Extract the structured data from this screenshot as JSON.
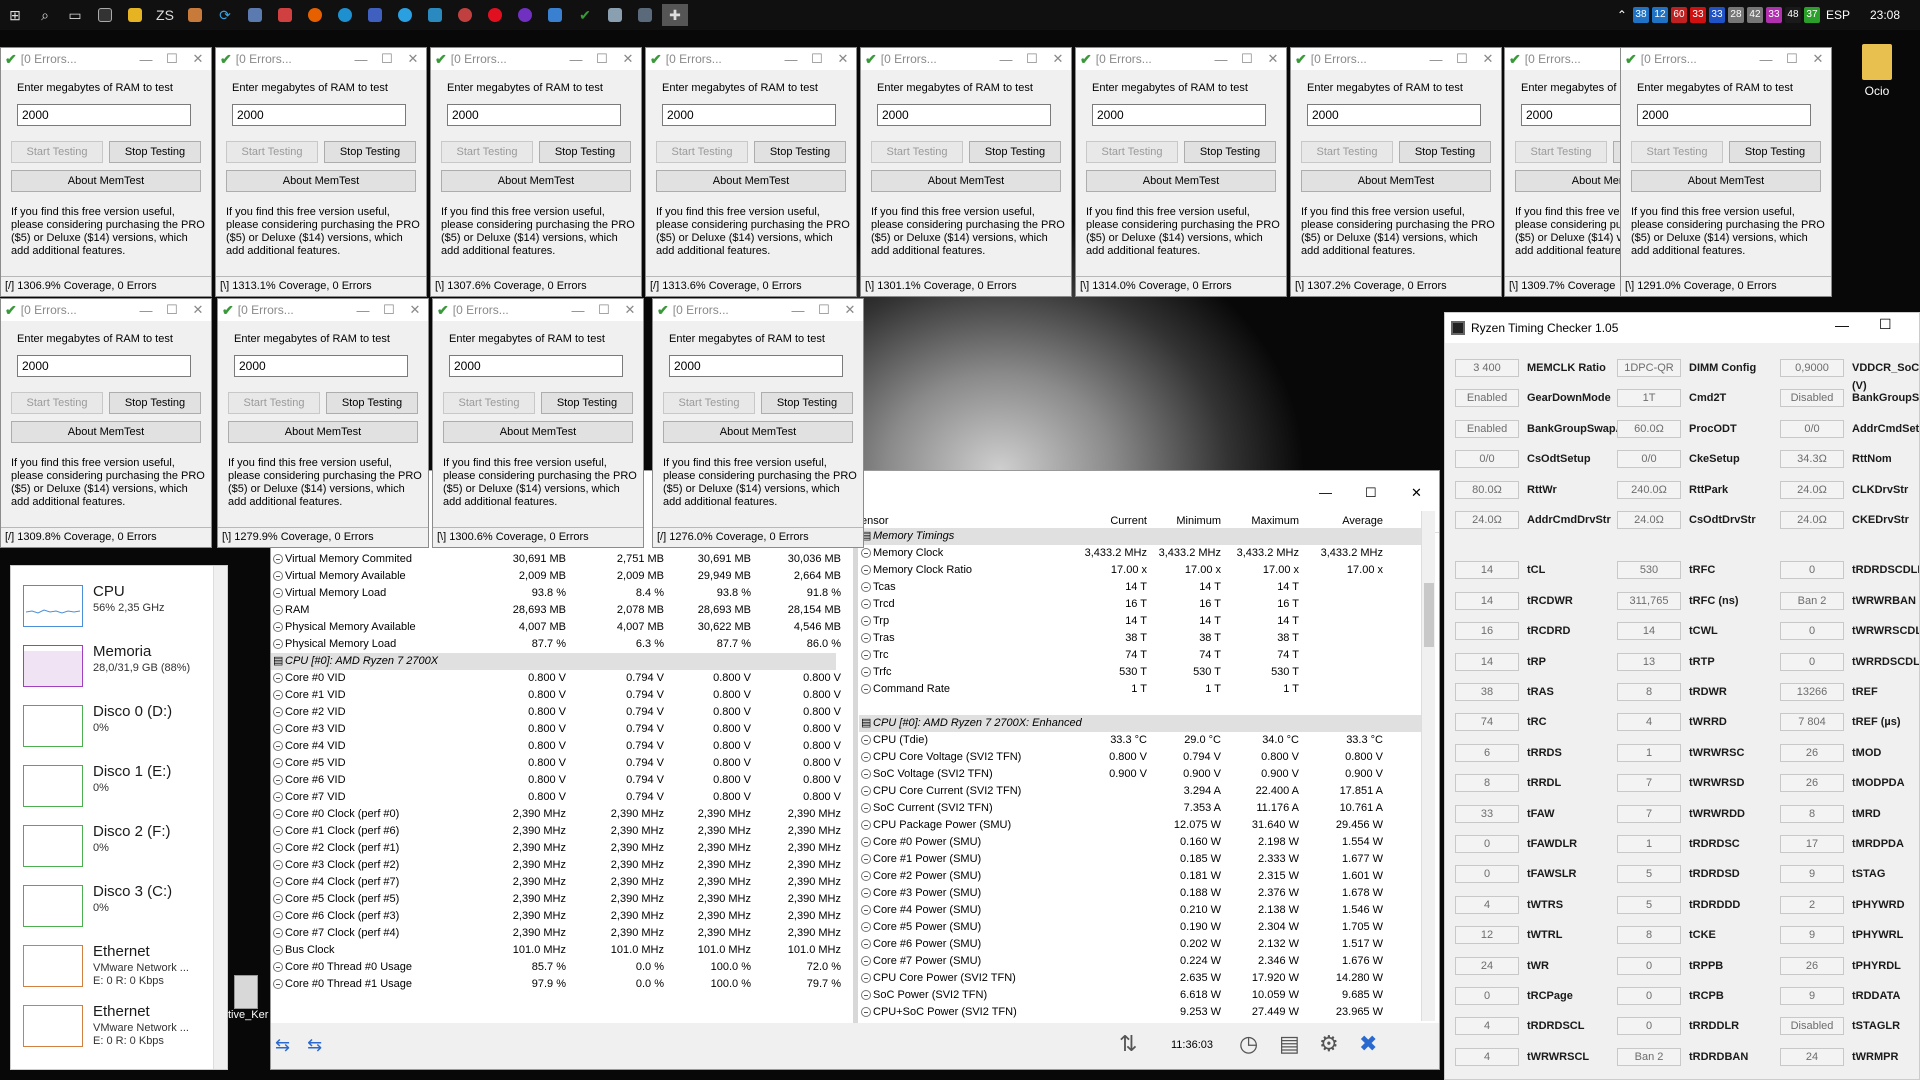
{
  "taskbar": {
    "lang": "ESP",
    "time": "23:08",
    "badges": [
      {
        "t": "38",
        "c": "#1f72c4"
      },
      {
        "t": "12",
        "c": "#1f72c4"
      },
      {
        "t": "60",
        "c": "#c02020"
      },
      {
        "t": "33",
        "c": "#d01010"
      },
      {
        "t": "33",
        "c": "#1f52c4"
      },
      {
        "t": "28",
        "c": "#777777"
      },
      {
        "t": "42",
        "c": "#777777"
      },
      {
        "t": "33",
        "c": "#b030b0"
      },
      {
        "t": "48",
        "c": "#1a1a1a"
      },
      {
        "t": "37",
        "c": "#2aa02a"
      }
    ]
  },
  "desktop": {
    "folder": "Ocio",
    "shortcut": "tive_Ker"
  },
  "memtest": {
    "title": "[0 Errors...",
    "label": "Enter megabytes of RAM to test",
    "value": "2000",
    "start": "Start Testing",
    "stop": "Stop Testing",
    "about": "About MemTest",
    "desc": "If you find this free version useful, please considering purchasing the PRO ($5) or Deluxe ($14) versions, which add additional features.",
    "status_row1": [
      "[/]  1306.9% Coverage, 0 Errors",
      "[\\]  1313.1% Coverage, 0 Errors",
      "[\\]  1307.6% Coverage, 0 Errors",
      "[/]  1313.6% Coverage, 0 Errors",
      "[\\]  1301.1% Coverage, 0 Errors",
      "[\\]  1314.0% Coverage, 0 Errors",
      "[\\]  1307.2% Coverage, 0 Errors",
      "[\\]  1309.7% Coverage",
      "[\\]  1291.0% Coverage, 0 Errors"
    ],
    "status_row2": [
      "[/]  1309.8% Coverage, 0 Errors",
      "[\\]  1279.9% Coverage, 0 Errors",
      "[\\]  1300.6% Coverage, 0 Errors",
      "[/]  1276.0% Coverage, 0 Errors"
    ]
  },
  "taskmanager": {
    "items": [
      {
        "name": "CPU",
        "sub": "56%  2,35 GHz",
        "color": "#4a8fd8"
      },
      {
        "name": "Memoria",
        "sub": "28,0/31,9 GB (88%)",
        "color": "#a040c0"
      },
      {
        "name": "Disco 0 (D:)",
        "sub": "0%",
        "color": "#4cb050"
      },
      {
        "name": "Disco 1 (E:)",
        "sub": "0%",
        "color": "#4cb050"
      },
      {
        "name": "Disco 2 (F:)",
        "sub": "0%",
        "color": "#4cb050"
      },
      {
        "name": "Disco 3 (C:)",
        "sub": "0%",
        "color": "#4cb050"
      },
      {
        "name": "Ethernet",
        "sub": "VMware Network ...\nE: 0 R: 0 Kbps",
        "color": "#d08040"
      },
      {
        "name": "Ethernet",
        "sub": "VMware Network ...\nE: 0 R: 0 Kbps",
        "color": "#d08040"
      }
    ]
  },
  "hwinfo": {
    "header": [
      "ensor",
      "Current",
      "Minimum",
      "Maximum",
      "Average"
    ],
    "clock": "11:36:03",
    "left": [
      [
        "r",
        "Virtual Memory Commited",
        "30,691 MB",
        "2,751 MB",
        "30,691 MB",
        "30,036 MB"
      ],
      [
        "r",
        "Virtual Memory Available",
        "2,009 MB",
        "2,009 MB",
        "29,949 MB",
        "2,664 MB"
      ],
      [
        "r",
        "Virtual Memory Load",
        "93.8 %",
        "8.4 %",
        "93.8 %",
        "91.8 %"
      ],
      [
        "r",
        "RAM",
        "28,693 MB",
        "2,078 MB",
        "28,693 MB",
        "28,154 MB"
      ],
      [
        "r",
        "Physical Memory Available",
        "4,007 MB",
        "4,007 MB",
        "30,622 MB",
        "4,546 MB"
      ],
      [
        "r",
        "Physical Memory Load",
        "87.7 %",
        "6.3 %",
        "87.7 %",
        "86.0 %"
      ],
      [
        "s",
        "CPU [#0]: AMD Ryzen 7 2700X"
      ],
      [
        "r",
        "Core #0 VID",
        "0.800 V",
        "0.794 V",
        "0.800 V",
        "0.800 V"
      ],
      [
        "r",
        "Core #1 VID",
        "0.800 V",
        "0.794 V",
        "0.800 V",
        "0.800 V"
      ],
      [
        "r",
        "Core #2 VID",
        "0.800 V",
        "0.794 V",
        "0.800 V",
        "0.800 V"
      ],
      [
        "r",
        "Core #3 VID",
        "0.800 V",
        "0.794 V",
        "0.800 V",
        "0.800 V"
      ],
      [
        "r",
        "Core #4 VID",
        "0.800 V",
        "0.794 V",
        "0.800 V",
        "0.800 V"
      ],
      [
        "r",
        "Core #5 VID",
        "0.800 V",
        "0.794 V",
        "0.800 V",
        "0.800 V"
      ],
      [
        "r",
        "Core #6 VID",
        "0.800 V",
        "0.794 V",
        "0.800 V",
        "0.800 V"
      ],
      [
        "r",
        "Core #7 VID",
        "0.800 V",
        "0.794 V",
        "0.800 V",
        "0.800 V"
      ],
      [
        "r",
        "Core #0 Clock (perf #0)",
        "2,390 MHz",
        "2,390 MHz",
        "2,390 MHz",
        "2,390 MHz"
      ],
      [
        "r",
        "Core #1 Clock (perf #6)",
        "2,390 MHz",
        "2,390 MHz",
        "2,390 MHz",
        "2,390 MHz"
      ],
      [
        "r",
        "Core #2 Clock (perf #1)",
        "2,390 MHz",
        "2,390 MHz",
        "2,390 MHz",
        "2,390 MHz"
      ],
      [
        "r",
        "Core #3 Clock (perf #2)",
        "2,390 MHz",
        "2,390 MHz",
        "2,390 MHz",
        "2,390 MHz"
      ],
      [
        "r",
        "Core #4 Clock (perf #7)",
        "2,390 MHz",
        "2,390 MHz",
        "2,390 MHz",
        "2,390 MHz"
      ],
      [
        "r",
        "Core #5 Clock (perf #5)",
        "2,390 MHz",
        "2,390 MHz",
        "2,390 MHz",
        "2,390 MHz"
      ],
      [
        "r",
        "Core #6 Clock (perf #3)",
        "2,390 MHz",
        "2,390 MHz",
        "2,390 MHz",
        "2,390 MHz"
      ],
      [
        "r",
        "Core #7 Clock (perf #4)",
        "2,390 MHz",
        "2,390 MHz",
        "2,390 MHz",
        "2,390 MHz"
      ],
      [
        "r",
        "Bus Clock",
        "101.0 MHz",
        "101.0 MHz",
        "101.0 MHz",
        "101.0 MHz"
      ],
      [
        "r",
        "Core #0 Thread #0 Usage",
        "85.7 %",
        "0.0 %",
        "100.0 %",
        "72.0 %"
      ],
      [
        "r",
        "Core #0 Thread #1 Usage",
        "97.9 %",
        "0.0 %",
        "100.0 %",
        "79.7 %"
      ]
    ],
    "right": [
      [
        "s",
        "Memory Timings"
      ],
      [
        "r",
        "Memory Clock",
        "3,433.2 MHz",
        "3,433.2 MHz",
        "3,433.2 MHz",
        "3,433.2 MHz"
      ],
      [
        "r",
        "Memory Clock Ratio",
        "17.00 x",
        "17.00 x",
        "17.00 x",
        "17.00 x"
      ],
      [
        "r",
        "Tcas",
        "14 T",
        "14 T",
        "14 T",
        ""
      ],
      [
        "r",
        "Trcd",
        "16 T",
        "16 T",
        "16 T",
        ""
      ],
      [
        "r",
        "Trp",
        "14 T",
        "14 T",
        "14 T",
        ""
      ],
      [
        "r",
        "Tras",
        "38 T",
        "38 T",
        "38 T",
        ""
      ],
      [
        "r",
        "Trc",
        "74 T",
        "74 T",
        "74 T",
        ""
      ],
      [
        "r",
        "Trfc",
        "530 T",
        "530 T",
        "530 T",
        ""
      ],
      [
        "r",
        "Command Rate",
        "1 T",
        "1 T",
        "1 T",
        ""
      ],
      [
        "e",
        ""
      ],
      [
        "s",
        "CPU [#0]: AMD Ryzen 7 2700X: Enhanced"
      ],
      [
        "r",
        "CPU (Tdie)",
        "33.3 °C",
        "29.0 °C",
        "34.0 °C",
        "33.3 °C"
      ],
      [
        "r",
        "CPU Core Voltage (SVI2 TFN)",
        "0.800 V",
        "0.794 V",
        "0.800 V",
        "0.800 V"
      ],
      [
        "r",
        "SoC Voltage (SVI2 TFN)",
        "0.900 V",
        "0.900 V",
        "0.900 V",
        "0.900 V"
      ],
      [
        "r",
        "CPU Core Current (SVI2 TFN)",
        "",
        "3.294 A",
        "22.400 A",
        "17.851 A"
      ],
      [
        "r",
        "SoC Current (SVI2 TFN)",
        "",
        "7.353 A",
        "11.176 A",
        "10.761 A"
      ],
      [
        "r",
        "CPU Package Power (SMU)",
        "",
        "12.075 W",
        "31.640 W",
        "29.456 W"
      ],
      [
        "r",
        "Core #0 Power (SMU)",
        "",
        "0.160 W",
        "2.198 W",
        "1.554 W"
      ],
      [
        "r",
        "Core #1 Power (SMU)",
        "",
        "0.185 W",
        "2.333 W",
        "1.677 W"
      ],
      [
        "r",
        "Core #2 Power (SMU)",
        "",
        "0.181 W",
        "2.315 W",
        "1.601 W"
      ],
      [
        "r",
        "Core #3 Power (SMU)",
        "",
        "0.188 W",
        "2.376 W",
        "1.678 W"
      ],
      [
        "r",
        "Core #4 Power (SMU)",
        "",
        "0.210 W",
        "2.138 W",
        "1.546 W"
      ],
      [
        "r",
        "Core #5 Power (SMU)",
        "",
        "0.190 W",
        "2.304 W",
        "1.705 W"
      ],
      [
        "r",
        "Core #6 Power (SMU)",
        "",
        "0.202 W",
        "2.132 W",
        "1.517 W"
      ],
      [
        "r",
        "Core #7 Power (SMU)",
        "",
        "0.224 W",
        "2.346 W",
        "1.676 W"
      ],
      [
        "r",
        "CPU Core Power (SVI2 TFN)",
        "",
        "2.635 W",
        "17.920 W",
        "14.280 W"
      ],
      [
        "r",
        "SoC Power (SVI2 TFN)",
        "",
        "6.618 W",
        "10.059 W",
        "9.685 W"
      ],
      [
        "r",
        "CPU+SoC Power (SVI2 TFN)",
        "",
        "9.253 W",
        "27.449 W",
        "23.965 W"
      ]
    ]
  },
  "rtc": {
    "title": "Ryzen Timing Checker 1.05",
    "rows": [
      [
        [
          "3 400",
          "MEMCLK Ratio"
        ],
        [
          "1DPC-QR",
          "DIMM Config"
        ],
        [
          "0,9000",
          "VDDCR_SoC (V)"
        ]
      ],
      [
        [
          "Enabled",
          "GearDownMode"
        ],
        [
          "1T",
          "Cmd2T"
        ],
        [
          "Disabled",
          "BankGroupSwap"
        ]
      ],
      [
        [
          "Enabled",
          "BankGroupSwapAlt"
        ],
        [
          "60.0Ω",
          "ProcODT"
        ],
        [
          "0/0",
          "AddrCmdSetup"
        ]
      ],
      [
        [
          "0/0",
          "CsOdtSetup"
        ],
        [
          "0/0",
          "CkeSetup"
        ],
        [
          "34.3Ω",
          "RttNom"
        ]
      ],
      [
        [
          "80.0Ω",
          "RttWr"
        ],
        [
          "240.0Ω",
          "RttPark"
        ],
        [
          "24.0Ω",
          "CLKDrvStr"
        ]
      ],
      [
        [
          "24.0Ω",
          "AddrCmdDrvStr"
        ],
        [
          "24.0Ω",
          "CsOdtDrvStr"
        ],
        [
          "24.0Ω",
          "CKEDrvStr"
        ]
      ],
      [],
      [
        [
          "14",
          "tCL"
        ],
        [
          "530",
          "tRFC"
        ],
        [
          "0",
          "tRDRDSCDLR"
        ]
      ],
      [
        [
          "14",
          "tRCDWR"
        ],
        [
          "311,765",
          "tRFC (ns)"
        ],
        [
          "Ban 2",
          "tWRWRBAN"
        ]
      ],
      [
        [
          "16",
          "tRCDRD"
        ],
        [
          "14",
          "tCWL"
        ],
        [
          "0",
          "tWRWRSCDLR"
        ]
      ],
      [
        [
          "14",
          "tRP"
        ],
        [
          "13",
          "tRTP"
        ],
        [
          "0",
          "tWRRDSCDLR"
        ]
      ],
      [
        [
          "38",
          "tRAS"
        ],
        [
          "8",
          "tRDWR"
        ],
        [
          "13266",
          "tREF"
        ]
      ],
      [
        [
          "74",
          "tRC"
        ],
        [
          "4",
          "tWRRD"
        ],
        [
          "7 804",
          "tREF (µs)"
        ]
      ],
      [
        [
          "6",
          "tRRDS"
        ],
        [
          "1",
          "tWRWRSC"
        ],
        [
          "26",
          "tMOD"
        ]
      ],
      [
        [
          "8",
          "tRRDL"
        ],
        [
          "7",
          "tWRWRSD"
        ],
        [
          "26",
          "tMODPDA"
        ]
      ],
      [
        [
          "33",
          "tFAW"
        ],
        [
          "7",
          "tWRWRDD"
        ],
        [
          "8",
          "tMRD"
        ]
      ],
      [
        [
          "0",
          "tFAWDLR"
        ],
        [
          "1",
          "tRDRDSC"
        ],
        [
          "17",
          "tMRDPDA"
        ]
      ],
      [
        [
          "0",
          "tFAWSLR"
        ],
        [
          "5",
          "tRDRDSD"
        ],
        [
          "9",
          "tSTAG"
        ]
      ],
      [
        [
          "4",
          "tWTRS"
        ],
        [
          "5",
          "tRDRDDD"
        ],
        [
          "2",
          "tPHYWRD"
        ]
      ],
      [
        [
          "12",
          "tWTRL"
        ],
        [
          "8",
          "tCKE"
        ],
        [
          "9",
          "tPHYWRL"
        ]
      ],
      [
        [
          "24",
          "tWR"
        ],
        [
          "0",
          "tRPPB"
        ],
        [
          "26",
          "tPHYRDL"
        ]
      ],
      [
        [
          "0",
          "tRCPage"
        ],
        [
          "0",
          "tRCPB"
        ],
        [
          "9",
          "tRDDATA"
        ]
      ],
      [
        [
          "4",
          "tRDRDSCL"
        ],
        [
          "0",
          "tRRDDLR"
        ],
        [
          "Disabled",
          "tSTAGLR"
        ]
      ],
      [
        [
          "4",
          "tWRWRSCL"
        ],
        [
          "Ban 2",
          "tRDRDBAN"
        ],
        [
          "24",
          "tWRMPR"
        ]
      ]
    ]
  }
}
